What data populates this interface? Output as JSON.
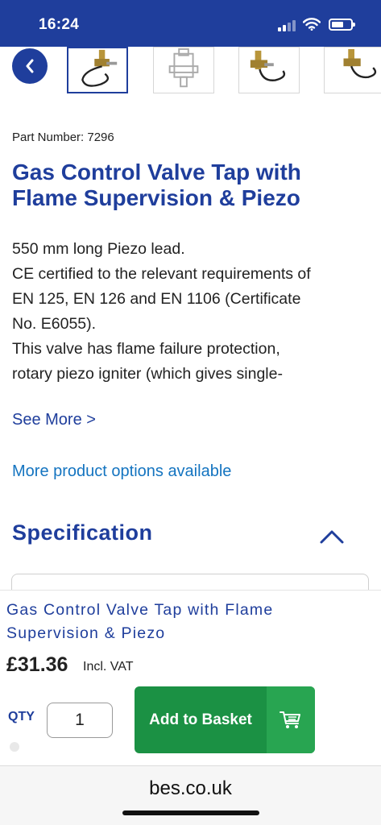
{
  "status_bar": {
    "time": "16:24",
    "icons": [
      "signal-icon",
      "wifi-icon",
      "battery-icon"
    ]
  },
  "carousel": {
    "back_icon": "chevron-left-icon",
    "thumbnails": [
      "valve-image-1",
      "valve-image-2",
      "valve-image-3",
      "valve-image-4"
    ]
  },
  "product": {
    "part_number": "Part Number: 7296",
    "title": "Gas Control Valve Tap with Flame Supervision & Piezo",
    "description_lines": [
      "550 mm long Piezo lead.",
      "CE certified to the relevant requirements of",
      "EN 125, EN 126 and EN 1106 (Certificate",
      "No. E6055).",
      "This valve has flame failure protection,",
      "rotary piezo igniter (which gives single-"
    ],
    "see_more": "See More >",
    "more_options": "More product options available"
  },
  "specification": {
    "title": "Specification",
    "toggle_icon": "chevron-up-icon"
  },
  "sticky": {
    "title": "Gas Control Valve Tap with Flame Supervision & Piezo",
    "price": "£31.36",
    "vat": "Incl. VAT",
    "qty_label": "QTY",
    "qty_value": "1",
    "basket_label": "Add to Basket",
    "basket_icon": "cart-icon"
  },
  "browser": {
    "url": "bes.co.uk"
  },
  "colors": {
    "brand_blue": "#1f3e9c",
    "link_blue": "#1474c0",
    "basket_green": "#1b9144",
    "basket_icon_green": "#28a551"
  }
}
